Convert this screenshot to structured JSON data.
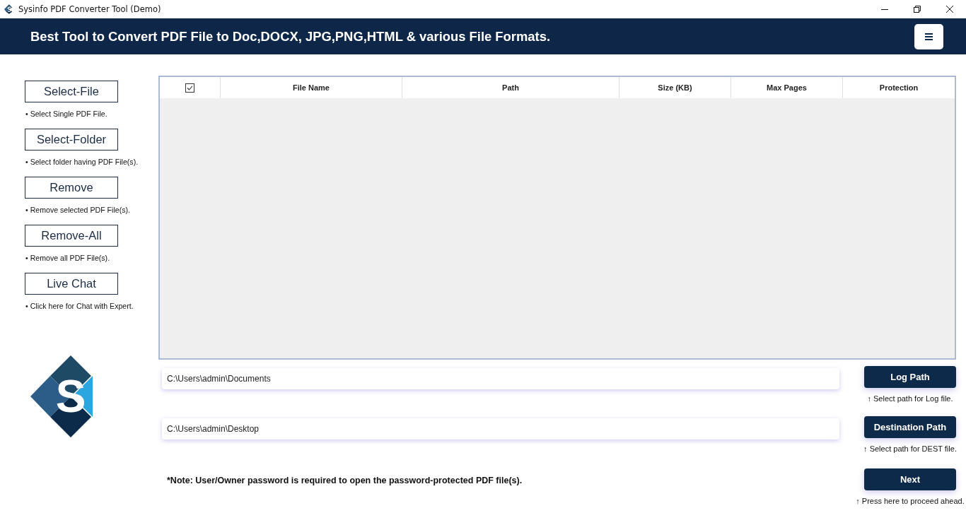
{
  "window": {
    "title": "Sysinfo PDF Converter Tool (Demo)"
  },
  "header": {
    "title": "Best Tool to Convert PDF File to Doc,DOCX, JPG,PNG,HTML & various File Formats."
  },
  "sidebar": {
    "actions": [
      {
        "label": "Select-File",
        "hint": "• Select Single PDF File."
      },
      {
        "label": "Select-Folder",
        "hint": "• Select folder having PDF File(s)."
      },
      {
        "label": "Remove",
        "hint": "• Remove selected PDF File(s)."
      },
      {
        "label": "Remove-All",
        "hint": "• Remove all PDF File(s)."
      },
      {
        "label": "Live Chat",
        "hint": "• Click here for Chat with Expert."
      }
    ],
    "logo": {
      "letter": "S"
    }
  },
  "table": {
    "select_all": {
      "checked": true
    },
    "columns": [
      "File Name",
      "Path",
      "Size (KB)",
      "Max Pages",
      "Protection"
    ]
  },
  "paths": [
    {
      "value": "C:\\Users\\admin\\Documents",
      "button": "Log Path",
      "hint": "↑ Select path for Log file."
    },
    {
      "value": "C:\\Users\\admin\\Desktop",
      "button": "Destination Path",
      "hint": "↑ Select path for DEST file."
    }
  ],
  "note": "*Note: User/Owner password is required to open the password-protected PDF file(s).",
  "next": {
    "label": "Next",
    "hint": "↑ Press here to proceed ahead."
  }
}
